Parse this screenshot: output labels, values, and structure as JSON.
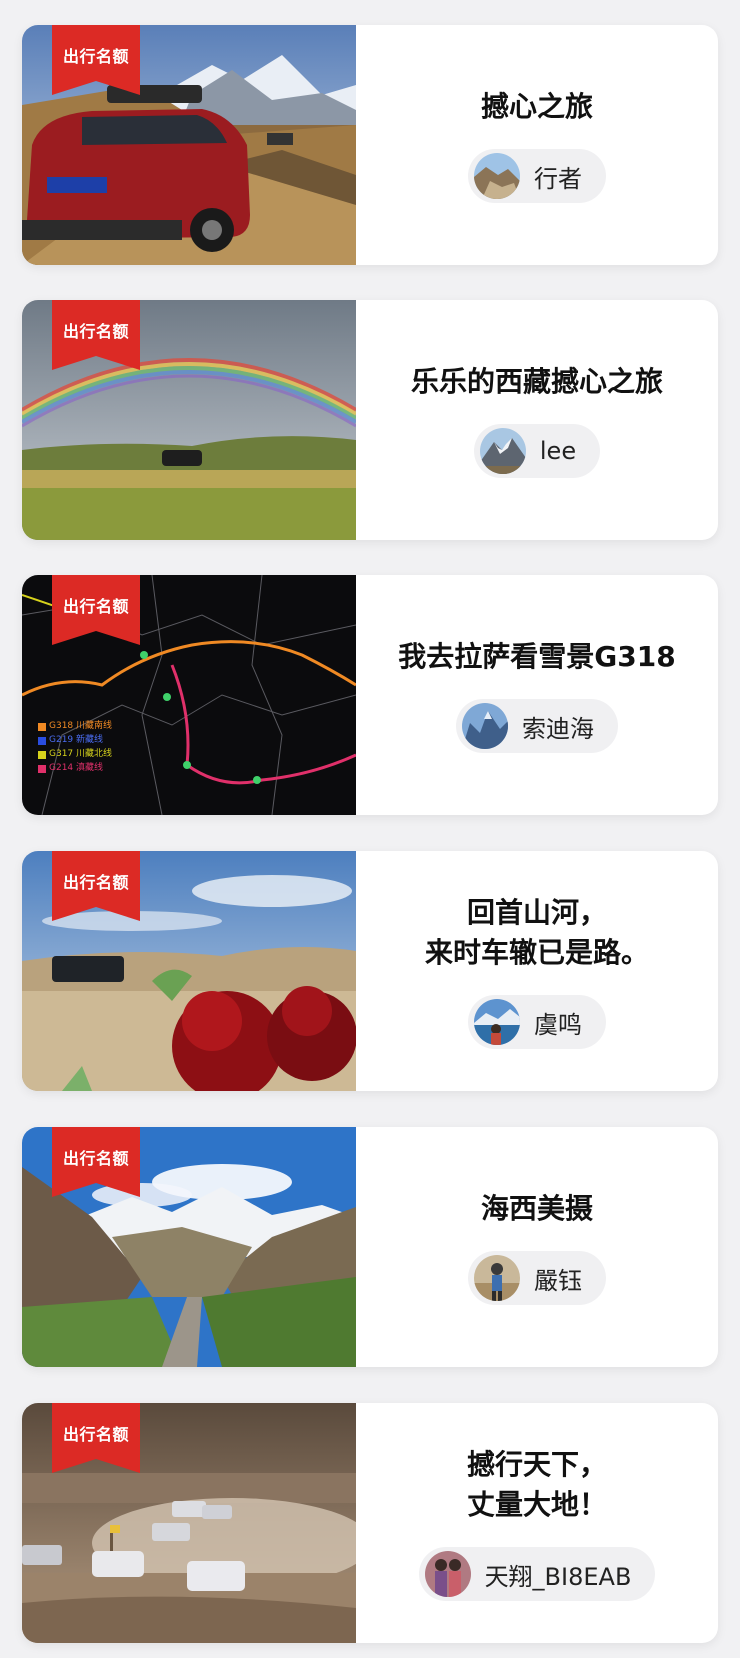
{
  "badge_text": "出行名额",
  "cards": [
    {
      "title": "撼心之旅",
      "author": "行者",
      "thumb": "red-suv-everest-photo",
      "avatar": "rock-mountain-avatar"
    },
    {
      "title": "乐乐的西藏撼心之旅",
      "author": "lee",
      "thumb": "rainbow-grassland-photo",
      "avatar": "snowy-peak-avatar"
    },
    {
      "title": "我去拉萨看雪景G318",
      "author": "索迪海",
      "thumb": "route-map-image",
      "avatar": "blue-mountain-avatar",
      "map_legend": [
        "G318 川藏南线",
        "G219 新藏线",
        "G317 川藏北线",
        "G214 滇藏线"
      ]
    },
    {
      "title": "回首山河，\n来时车辙已是路。",
      "author": "虞鸣",
      "thumb": "desert-rose-photo",
      "avatar": "lake-person-avatar"
    },
    {
      "title": "海西美摄",
      "author": "嚴钰",
      "thumb": "valley-snow-mountain-photo",
      "avatar": "hiker-avatar"
    },
    {
      "title": "撼行天下，\n丈量大地！",
      "author": "天翔_BI8EAB",
      "thumb": "desert-convoy-photo",
      "avatar": "couple-avatar"
    }
  ]
}
